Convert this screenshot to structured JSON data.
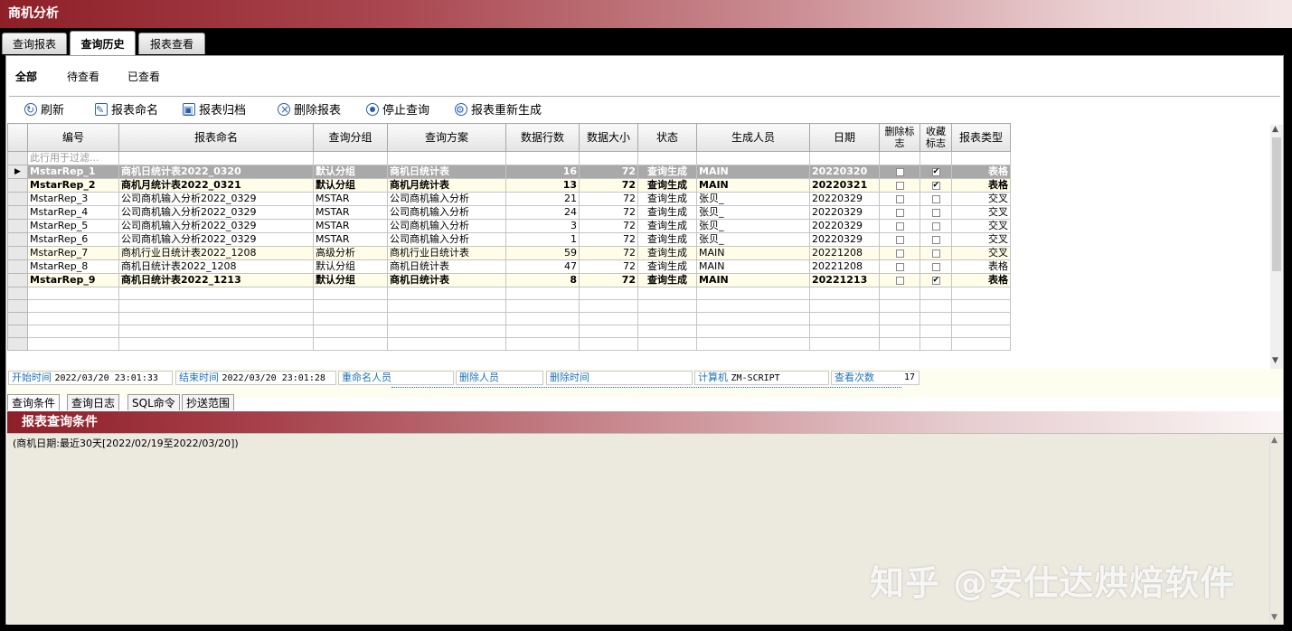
{
  "window": {
    "title": "商机分析"
  },
  "tabs": [
    {
      "label": "查询报表"
    },
    {
      "label": "查询历史"
    },
    {
      "label": "报表查看"
    }
  ],
  "filters": [
    {
      "label": "全部"
    },
    {
      "label": "待查看"
    },
    {
      "label": "已查看"
    }
  ],
  "toolbar": [
    {
      "label": "刷新",
      "icon": "refresh-icon"
    },
    {
      "label": "报表命名",
      "icon": "rename-icon"
    },
    {
      "label": "报表归档",
      "icon": "archive-icon"
    },
    {
      "label": "删除报表",
      "icon": "delete-icon"
    },
    {
      "label": "停止查询",
      "icon": "stop-icon"
    },
    {
      "label": "报表重新生成",
      "icon": "regenerate-icon"
    }
  ],
  "grid": {
    "columns": [
      "编号",
      "报表命名",
      "查询分组",
      "查询方案",
      "数据行数",
      "数据大小",
      "状态",
      "生成人员",
      "日期",
      "删除标志",
      "收藏标志",
      "报表类型"
    ],
    "filter_placeholder": "此行用于过滤...",
    "rows": [
      {
        "id": "MstarRep_1",
        "name": "商机日统计表2022_0320",
        "group": "默认分组",
        "plan": "商机日统计表",
        "rows": "16",
        "size": "72",
        "status": "查询生成",
        "user": "MAIN",
        "date": "20220320",
        "deleted": false,
        "fav": true,
        "type": "表格"
      },
      {
        "id": "MstarRep_2",
        "name": "商机月统计表2022_0321",
        "group": "默认分组",
        "plan": "商机月统计表",
        "rows": "13",
        "size": "72",
        "status": "查询生成",
        "user": "MAIN",
        "date": "20220321",
        "deleted": false,
        "fav": true,
        "type": "表格"
      },
      {
        "id": "MstarRep_3",
        "name": "公司商机输入分析2022_0329",
        "group": "MSTAR",
        "plan": "公司商机输入分析",
        "rows": "21",
        "size": "72",
        "status": "查询生成",
        "user": "张贝_",
        "date": "20220329",
        "deleted": false,
        "fav": false,
        "type": "交叉"
      },
      {
        "id": "MstarRep_4",
        "name": "公司商机输入分析2022_0329",
        "group": "MSTAR",
        "plan": "公司商机输入分析",
        "rows": "24",
        "size": "72",
        "status": "查询生成",
        "user": "张贝_",
        "date": "20220329",
        "deleted": false,
        "fav": false,
        "type": "交叉"
      },
      {
        "id": "MstarRep_5",
        "name": "公司商机输入分析2022_0329",
        "group": "MSTAR",
        "plan": "公司商机输入分析",
        "rows": "3",
        "size": "72",
        "status": "查询生成",
        "user": "张贝_",
        "date": "20220329",
        "deleted": false,
        "fav": false,
        "type": "交叉"
      },
      {
        "id": "MstarRep_6",
        "name": "公司商机输入分析2022_0329",
        "group": "MSTAR",
        "plan": "公司商机输入分析",
        "rows": "1",
        "size": "72",
        "status": "查询生成",
        "user": "张贝_",
        "date": "20220329",
        "deleted": false,
        "fav": false,
        "type": "交叉"
      },
      {
        "id": "MstarRep_7",
        "name": "商机行业日统计表2022_1208",
        "group": "高级分析",
        "plan": "商机行业日统计表",
        "rows": "59",
        "size": "72",
        "status": "查询生成",
        "user": "MAIN",
        "date": "20221208",
        "deleted": false,
        "fav": false,
        "type": "交叉"
      },
      {
        "id": "MstarRep_8",
        "name": "商机日统计表2022_1208",
        "group": "默认分组",
        "plan": "商机日统计表",
        "rows": "47",
        "size": "72",
        "status": "查询生成",
        "user": "MAIN",
        "date": "20221208",
        "deleted": false,
        "fav": false,
        "type": "表格"
      },
      {
        "id": "MstarRep_9",
        "name": "商机日统计表2022_1213",
        "group": "默认分组",
        "plan": "商机日统计表",
        "rows": "8",
        "size": "72",
        "status": "查询生成",
        "user": "MAIN",
        "date": "20221213",
        "deleted": false,
        "fav": true,
        "type": "表格"
      }
    ]
  },
  "info": {
    "start_label": "开始时间",
    "start_value": "2022/03/20 23:01:33",
    "end_label": "结束时间",
    "end_value": "2022/03/20 23:01:28",
    "rename_label": "重命名人员",
    "deleter_label": "删除人员",
    "delete_time_label": "删除时间",
    "computer_label": "计算机",
    "computer_value": "ZM-SCRIPT",
    "views_label": "查看次数",
    "views_value": "17"
  },
  "subtabs": [
    {
      "label": "查询条件"
    },
    {
      "label": "查询日志"
    },
    {
      "label": "SQL命令"
    },
    {
      "label": "抄送范围"
    }
  ],
  "conditions": {
    "title": "报表查询条件",
    "text": "(商机日期:最近30天[2022/02/19至2022/03/20])"
  },
  "watermark": "知乎 @安仕达烘焙软件"
}
